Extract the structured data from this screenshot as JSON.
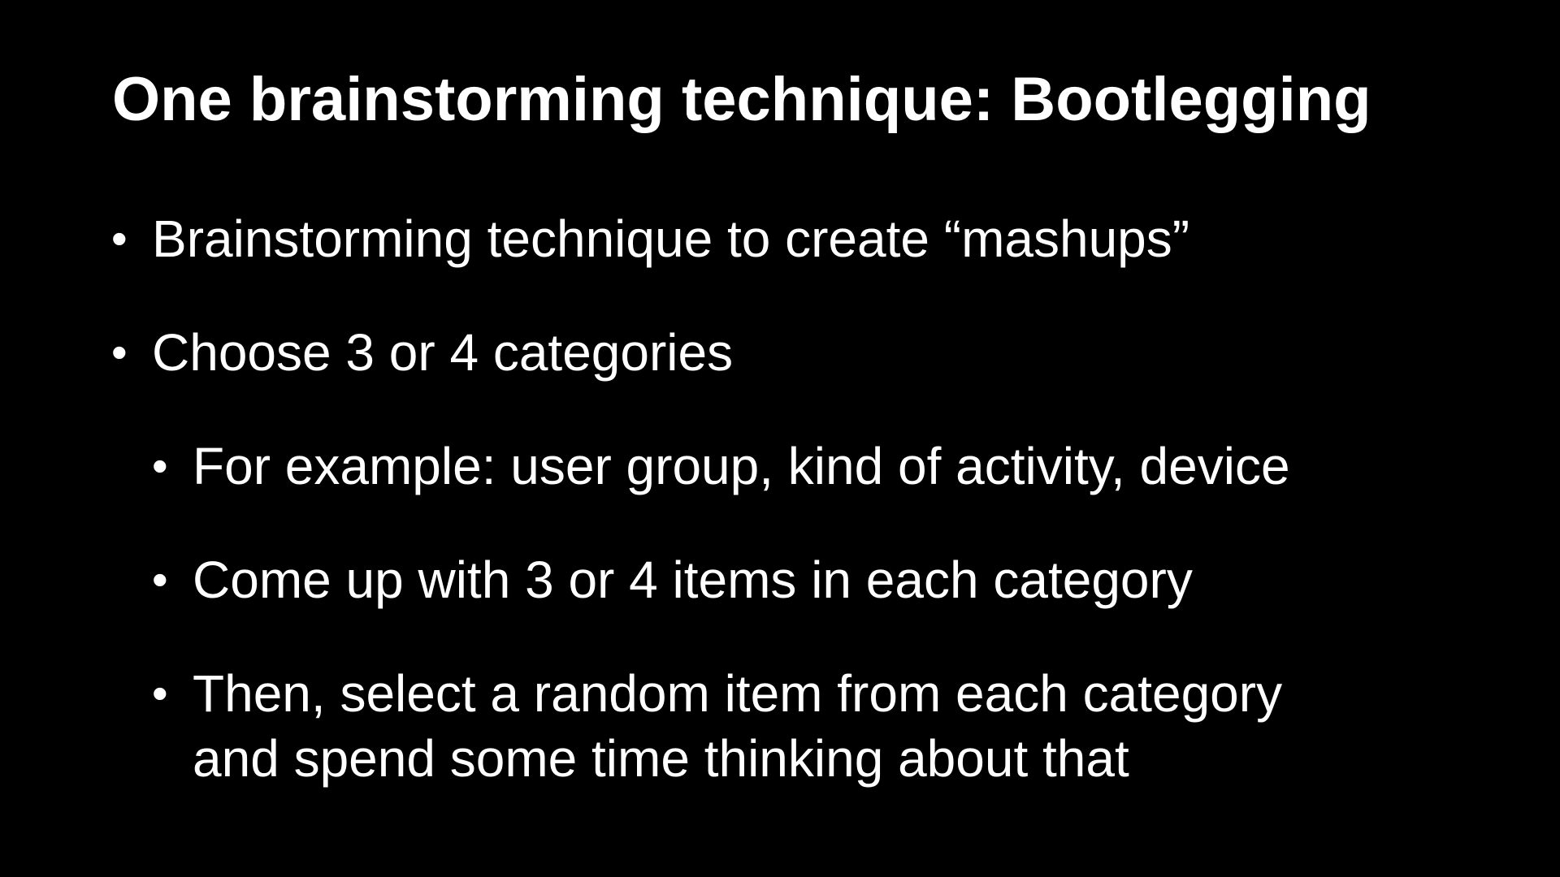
{
  "slide": {
    "title": "One brainstorming technique: Bootlegging",
    "bullets": [
      {
        "level": 1,
        "text": "Brainstorming technique to create “mashups”"
      },
      {
        "level": 1,
        "text": "Choose 3 or 4 categories"
      },
      {
        "level": 2,
        "text": "For example: user group, kind of activity, device"
      },
      {
        "level": 2,
        "text": "Come up with 3 or 4 items in each category"
      },
      {
        "level": 2,
        "lines": [
          "Then, select a random item from each category",
          "and spend some time thinking about that"
        ]
      }
    ],
    "bullet_glyph": "•",
    "colors": {
      "background": "#000000",
      "text": "#ffffff"
    }
  }
}
